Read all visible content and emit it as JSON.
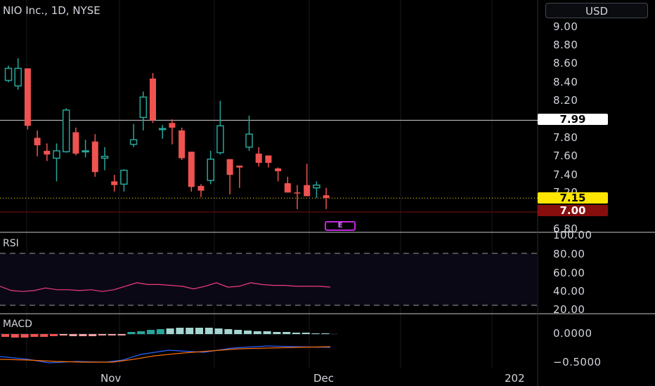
{
  "header": {
    "title": "NIO Inc., 1D, NYSE",
    "currency_button": "USD"
  },
  "price_axis": {
    "ticks": [
      "9.00",
      "8.80",
      "8.60",
      "8.40",
      "8.20",
      "7.80",
      "7.60",
      "7.40",
      "7.20",
      "6.80"
    ]
  },
  "tags": {
    "line_price": "7.99",
    "last_price": "7.15",
    "low_price": "7.00"
  },
  "earnings_marker": "E",
  "rsi": {
    "label": "RSI",
    "ticks": [
      "100.00",
      "80.00",
      "60.00",
      "40.00",
      "20.00"
    ],
    "values": [
      42,
      37,
      36,
      37,
      40,
      38,
      38,
      37,
      38,
      36,
      38,
      42,
      46,
      44,
      44,
      43,
      42,
      39,
      42,
      46,
      41,
      42,
      46,
      44,
      43,
      43,
      42,
      42,
      42,
      41
    ]
  },
  "macd": {
    "label": "MACD",
    "ticks": [
      "0.0000",
      "−0.5000"
    ]
  },
  "time_axis": {
    "labels": [
      "Nov",
      "Dec",
      "202"
    ]
  },
  "colors": {
    "up": "#26a69a",
    "down": "#ef5350",
    "rsi_line": "#f23d7a",
    "macd_line": "#2962ff",
    "signal_line": "#ff6d00"
  },
  "chart_data": {
    "type": "candlestick",
    "title": "NIO Inc., 1D, NYSE",
    "ylim": [
      6.78,
      9.1
    ],
    "horizontal_line": 7.99,
    "last_price": 7.15,
    "candles": [
      {
        "o": 8.42,
        "h": 8.58,
        "l": 8.4,
        "c": 8.55
      },
      {
        "o": 8.36,
        "h": 8.66,
        "l": 8.32,
        "c": 8.55
      },
      {
        "o": 8.55,
        "h": 8.55,
        "l": 7.89,
        "c": 7.93
      },
      {
        "o": 7.8,
        "h": 7.88,
        "l": 7.6,
        "c": 7.72
      },
      {
        "o": 7.66,
        "h": 7.74,
        "l": 7.55,
        "c": 7.62
      },
      {
        "o": 7.58,
        "h": 7.74,
        "l": 7.33,
        "c": 7.66
      },
      {
        "o": 7.65,
        "h": 8.12,
        "l": 7.64,
        "c": 8.1
      },
      {
        "o": 7.86,
        "h": 7.91,
        "l": 7.61,
        "c": 7.63
      },
      {
        "o": 7.66,
        "h": 7.78,
        "l": 7.59,
        "c": 7.66
      },
      {
        "o": 7.76,
        "h": 7.84,
        "l": 7.38,
        "c": 7.43
      },
      {
        "o": 7.58,
        "h": 7.7,
        "l": 7.45,
        "c": 7.6
      },
      {
        "o": 7.33,
        "h": 7.4,
        "l": 7.22,
        "c": 7.29
      },
      {
        "o": 7.3,
        "h": 7.46,
        "l": 7.22,
        "c": 7.45
      },
      {
        "o": 7.73,
        "h": 7.95,
        "l": 7.7,
        "c": 7.78
      },
      {
        "o": 8.02,
        "h": 8.3,
        "l": 7.88,
        "c": 8.24
      },
      {
        "o": 8.44,
        "h": 8.5,
        "l": 7.96,
        "c": 7.99
      },
      {
        "o": 7.9,
        "h": 7.94,
        "l": 7.79,
        "c": 7.9
      },
      {
        "o": 7.96,
        "h": 8.0,
        "l": 7.73,
        "c": 7.91
      },
      {
        "o": 7.88,
        "h": 7.91,
        "l": 7.56,
        "c": 7.58
      },
      {
        "o": 7.65,
        "h": 7.65,
        "l": 7.22,
        "c": 7.27
      },
      {
        "o": 7.28,
        "h": 7.3,
        "l": 7.16,
        "c": 7.23
      },
      {
        "o": 7.34,
        "h": 7.66,
        "l": 7.3,
        "c": 7.57
      },
      {
        "o": 7.64,
        "h": 8.2,
        "l": 7.62,
        "c": 7.93
      },
      {
        "o": 7.57,
        "h": 7.57,
        "l": 7.19,
        "c": 7.4
      },
      {
        "o": 7.5,
        "h": 7.5,
        "l": 7.26,
        "c": 7.48
      },
      {
        "o": 7.7,
        "h": 8.04,
        "l": 7.66,
        "c": 7.84
      },
      {
        "o": 7.63,
        "h": 7.7,
        "l": 7.49,
        "c": 7.53
      },
      {
        "o": 7.61,
        "h": 7.61,
        "l": 7.48,
        "c": 7.53
      },
      {
        "o": 7.47,
        "h": 7.48,
        "l": 7.33,
        "c": 7.44
      },
      {
        "o": 7.31,
        "h": 7.38,
        "l": 7.21,
        "c": 7.21
      },
      {
        "o": 7.21,
        "h": 7.29,
        "l": 7.03,
        "c": 7.2
      },
      {
        "o": 7.29,
        "h": 7.52,
        "l": 7.19,
        "c": 7.17
      },
      {
        "o": 7.26,
        "h": 7.33,
        "l": 7.15,
        "c": 7.29
      },
      {
        "o": 7.18,
        "h": 7.26,
        "l": 7.03,
        "c": 7.15
      }
    ]
  }
}
